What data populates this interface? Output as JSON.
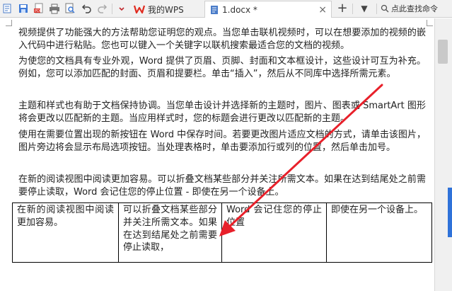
{
  "tabs": [
    {
      "label": "我的WPS"
    },
    {
      "label": "1.docx *"
    }
  ],
  "search": {
    "label": "点此查找命令"
  },
  "doc": {
    "paragraphs": [
      "视频提供了功能强大的方法帮助您证明您的观点。当您单击联机视频时，可以在想要添加的视频的嵌入代码中进行粘贴。您也可以键入一个关键字以联机搜索最适合您的文档的视频。",
      "为使您的文档具有专业外观，Word 提供了页眉、页脚、封面和文本框设计，这些设计可互为补充。例如，您可以添加匹配的封面、页眉和提要栏。单击“插入”，然后从不同库中选择所需元素。",
      "主题和样式也有助于文档保持协调。当您单击设计并选择新的主题时，图片、图表或 SmartArt 图形将会更改以匹配新的主题。当应用样式时，您的标题会进行更改以匹配新的主题。",
      "使用在需要位置出现的新按钮在 Word 中保存时间。若要更改图片适应文档的方式，请单击该图片，图片旁边将会显示布局选项按钮。当处理表格时，单击要添加行或列的位置，然后单击加号。",
      "在新的阅读视图中阅读更加容易。可以折叠文档某些部分并关注所需文本。如果在达到结尾处之前需要停止读取，Word 会记住您的停止位置 - 即使在另一个设备上。"
    ],
    "table": [
      [
        "在新的阅读视图中阅读更加容易。",
        "可以折叠文档某些部分并关注所需文本。如果在达到结尾处之前需要停止读取，",
        "Word 会记住您的停止位置",
        "即使在另一个设备上。"
      ]
    ]
  },
  "colors": {
    "accent": "#2f72d9",
    "annotation_arrow": "#e8202a",
    "wps_logo": "#e02b20"
  },
  "icons": [
    "app-menu-icon",
    "save-icon",
    "export-pdf-icon",
    "print-icon",
    "print-preview-icon",
    "undo-icon",
    "redo-icon",
    "quick-access-dropdown-icon",
    "wps-logo-icon",
    "document-icon",
    "close-icon",
    "add-tab-icon",
    "more-tabs-icon",
    "search-icon"
  ]
}
